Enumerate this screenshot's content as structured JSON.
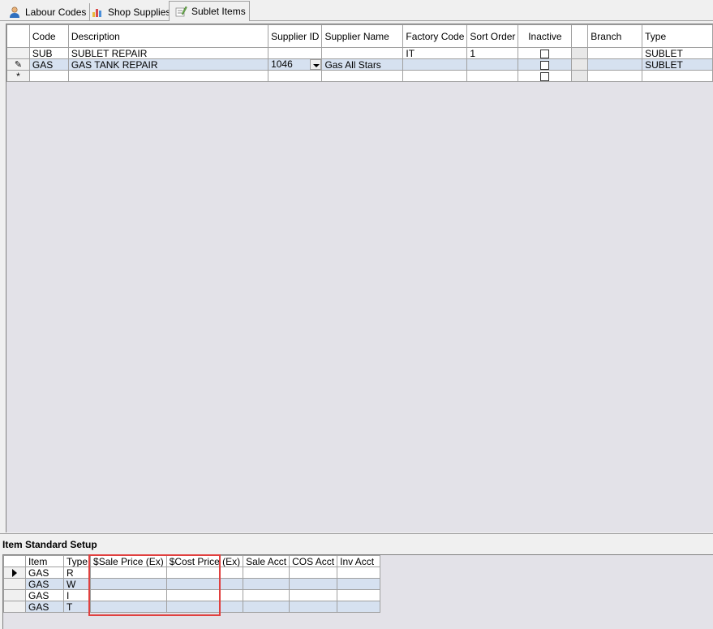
{
  "tabs": [
    {
      "label": "Labour Codes",
      "icon": "person-icon"
    },
    {
      "label": "Shop Supplies",
      "icon": "bar-chart-icon"
    },
    {
      "label": "Sublet Items",
      "icon": "pencil-note-icon"
    }
  ],
  "main_grid": {
    "columns": [
      "Code",
      "Description",
      "Supplier ID",
      "Supplier Name",
      "Factory Code",
      "Sort Order",
      "Inactive",
      "",
      "Branch",
      "Type"
    ],
    "rows": [
      {
        "selector": "",
        "code": "SUB",
        "description": "SUBLET REPAIR",
        "supplier_id": "",
        "supplier_name": "",
        "factory_code": "IT",
        "sort_order": "1",
        "inactive": false,
        "branch": "",
        "type": "SUBLET"
      },
      {
        "selector": "✎",
        "code": "GAS",
        "description": "GAS TANK REPAIR",
        "supplier_id": "1046",
        "supplier_name": "Gas All Stars",
        "factory_code": "",
        "sort_order": "",
        "inactive": false,
        "branch": "",
        "type": "SUBLET"
      },
      {
        "selector": "*",
        "code": "",
        "description": "",
        "supplier_id": "",
        "supplier_name": "",
        "factory_code": "",
        "sort_order": "",
        "inactive": false,
        "branch": "",
        "type": ""
      }
    ]
  },
  "setup": {
    "title": "Item Standard Setup",
    "columns": [
      "Item",
      "Type",
      "$Sale Price (Ex)",
      "$Cost Price (Ex)",
      "Sale Acct",
      "COS Acct",
      "Inv Acct"
    ],
    "rows": [
      {
        "item": "GAS",
        "type": "R"
      },
      {
        "item": "GAS",
        "type": "W"
      },
      {
        "item": "GAS",
        "type": "I"
      },
      {
        "item": "GAS",
        "type": "T"
      }
    ]
  },
  "colors": {
    "highlight_row": "#d6e1f0",
    "grid_bg": "#e3e2e8",
    "annotation_box": "#e0403f"
  }
}
